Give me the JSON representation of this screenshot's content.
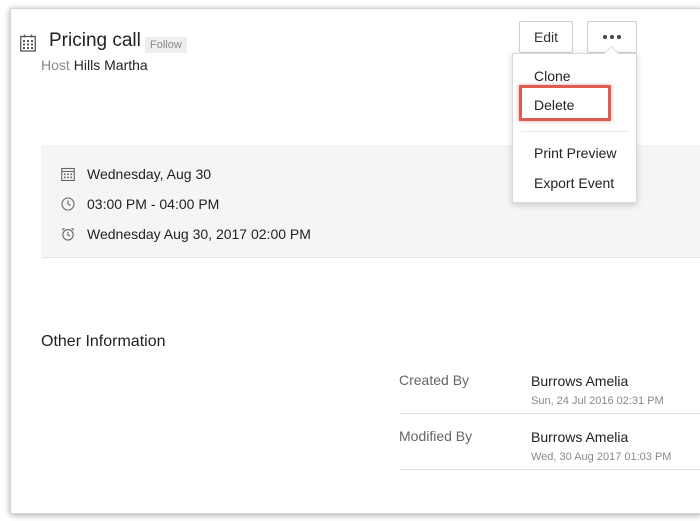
{
  "event": {
    "title": "Pricing call",
    "follow_label": "Follow",
    "host_label": "Host",
    "host_name": "Hills Martha"
  },
  "toolbar": {
    "edit_label": "Edit",
    "more_icon": "more-horizontal-icon"
  },
  "menu": {
    "items": [
      {
        "label": "Clone"
      },
      {
        "label": "Delete"
      },
      {
        "label": "Print Preview"
      },
      {
        "label": "Export Event"
      }
    ],
    "highlighted_item": "Delete",
    "highlight_color": "#e05b50"
  },
  "details": {
    "date": "Wednesday, Aug 30",
    "time_start": "03:00 PM",
    "time_separator": " - ",
    "time_end": "04:00 PM",
    "reminder": "Wednesday Aug 30, 2017 02:00 PM"
  },
  "other_info": {
    "title": "Other Information",
    "rows": [
      {
        "label": "Created By",
        "name": "Burrows Amelia",
        "time": "Sun, 24 Jul 2016 02:31 PM"
      },
      {
        "label": "Modified By",
        "name": "Burrows Amelia",
        "time": "Wed, 30 Aug 2017 01:03 PM"
      }
    ]
  },
  "icons": {
    "event": "calendar-grid-icon",
    "date": "calendar-icon",
    "time": "clock-icon",
    "reminder": "alarm-clock-icon"
  }
}
